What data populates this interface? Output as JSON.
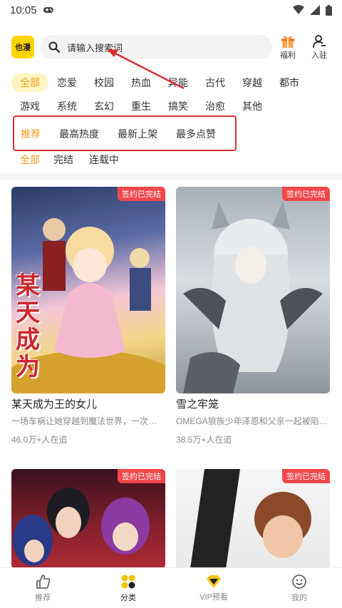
{
  "status_bar": {
    "time": "10:05"
  },
  "header": {
    "logo_text": "也漫",
    "search_placeholder": "请输入搜索词",
    "welfare_label": "福利",
    "join_label": "入驻"
  },
  "genres_row1": [
    "全部",
    "恋爱",
    "校园",
    "热血",
    "异能",
    "古代",
    "穿越",
    "都市"
  ],
  "genres_row2": [
    "游戏",
    "系统",
    "玄幻",
    "重生",
    "搞笑",
    "治愈",
    "其他"
  ],
  "sort_options": [
    "推荐",
    "最高热度",
    "最新上架",
    "最多点赞"
  ],
  "status_options": [
    "全部",
    "完结",
    "连载中"
  ],
  "comics": [
    {
      "badge": "签约已完结",
      "title": "某天成为王的女儿",
      "desc": "一场车祸让她穿越到魔法世界，一次…",
      "followers": "46.0万+人在追",
      "cover_text": "某天成为"
    },
    {
      "badge": "签约已完结",
      "title": "雪之牢笼",
      "desc": "OMEGA狼族少年泽恩和父亲一起被陷…",
      "followers": "38.5万+人在追",
      "cover_text": ""
    },
    {
      "badge": "签约已完结",
      "title": "",
      "desc": "",
      "followers": "",
      "cover_text": ""
    },
    {
      "badge": "签约已完结",
      "title": "",
      "desc": "",
      "followers": "",
      "cover_text": ""
    }
  ],
  "bottom_nav": [
    {
      "label": "推荐",
      "icon": "thumbs-up-icon"
    },
    {
      "label": "分类",
      "icon": "category-grid-icon"
    },
    {
      "label": "VIP预看",
      "icon": "vip-diamond-icon"
    },
    {
      "label": "我的",
      "icon": "smile-face-icon"
    }
  ],
  "colors": {
    "accent": "#ff9a1f",
    "active_chip_bg": "#fff5c2",
    "badge": "#f0474b",
    "highlight": "#d9302f",
    "logo": "#ffd400"
  }
}
